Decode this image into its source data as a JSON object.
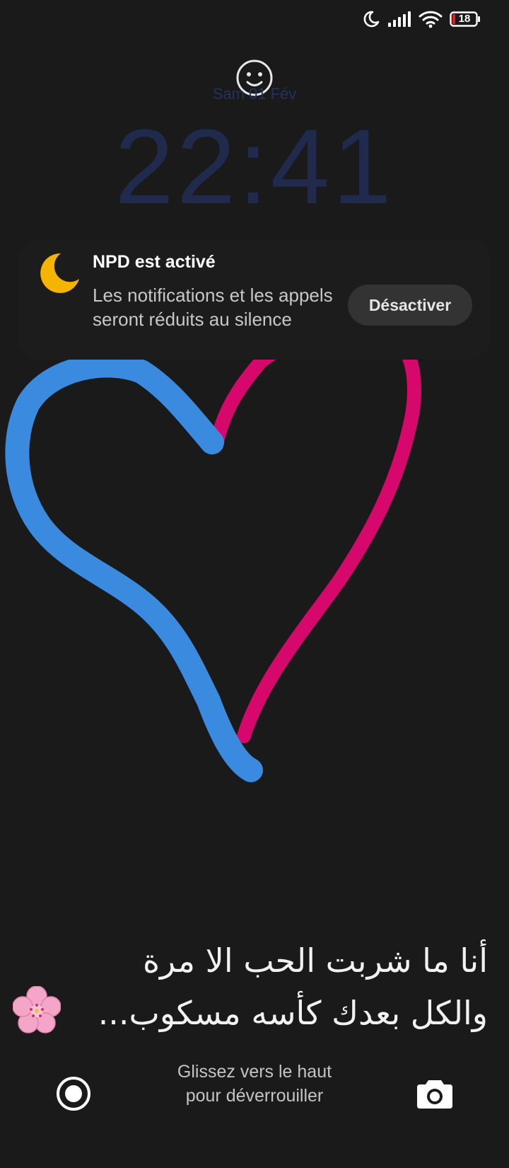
{
  "status_bar": {
    "icons": [
      "dnd-moon-icon",
      "signal-icon",
      "wifi-icon",
      "battery-icon"
    ],
    "battery_level": "18",
    "battery_low_color": "#e01e1e"
  },
  "lock_screen": {
    "date": "Sam 01 Fév",
    "time": "22:41"
  },
  "notification": {
    "icon": "moon-icon",
    "icon_color": "#f5b400",
    "title": "NPD est activé",
    "body": "Les notifications et les appels seront réduits au silence",
    "button_label": "Désactiver"
  },
  "wallpaper": {
    "drawing": "heart-icon",
    "left_stroke_color": "#3a8be0",
    "right_stroke_color": "#d6086b",
    "quote_lines": [
      "أنا ما شربت الحب الا مرة",
      "والكل بعدك كأسه مسكوب..."
    ],
    "emoji": "cherry-blossom-icon"
  },
  "bottom_bar": {
    "unlock_hint_lines": [
      "Glissez vers le haut",
      "pour déverrouiller"
    ],
    "left_shortcut": "record-icon",
    "right_shortcut": "camera-icon"
  }
}
